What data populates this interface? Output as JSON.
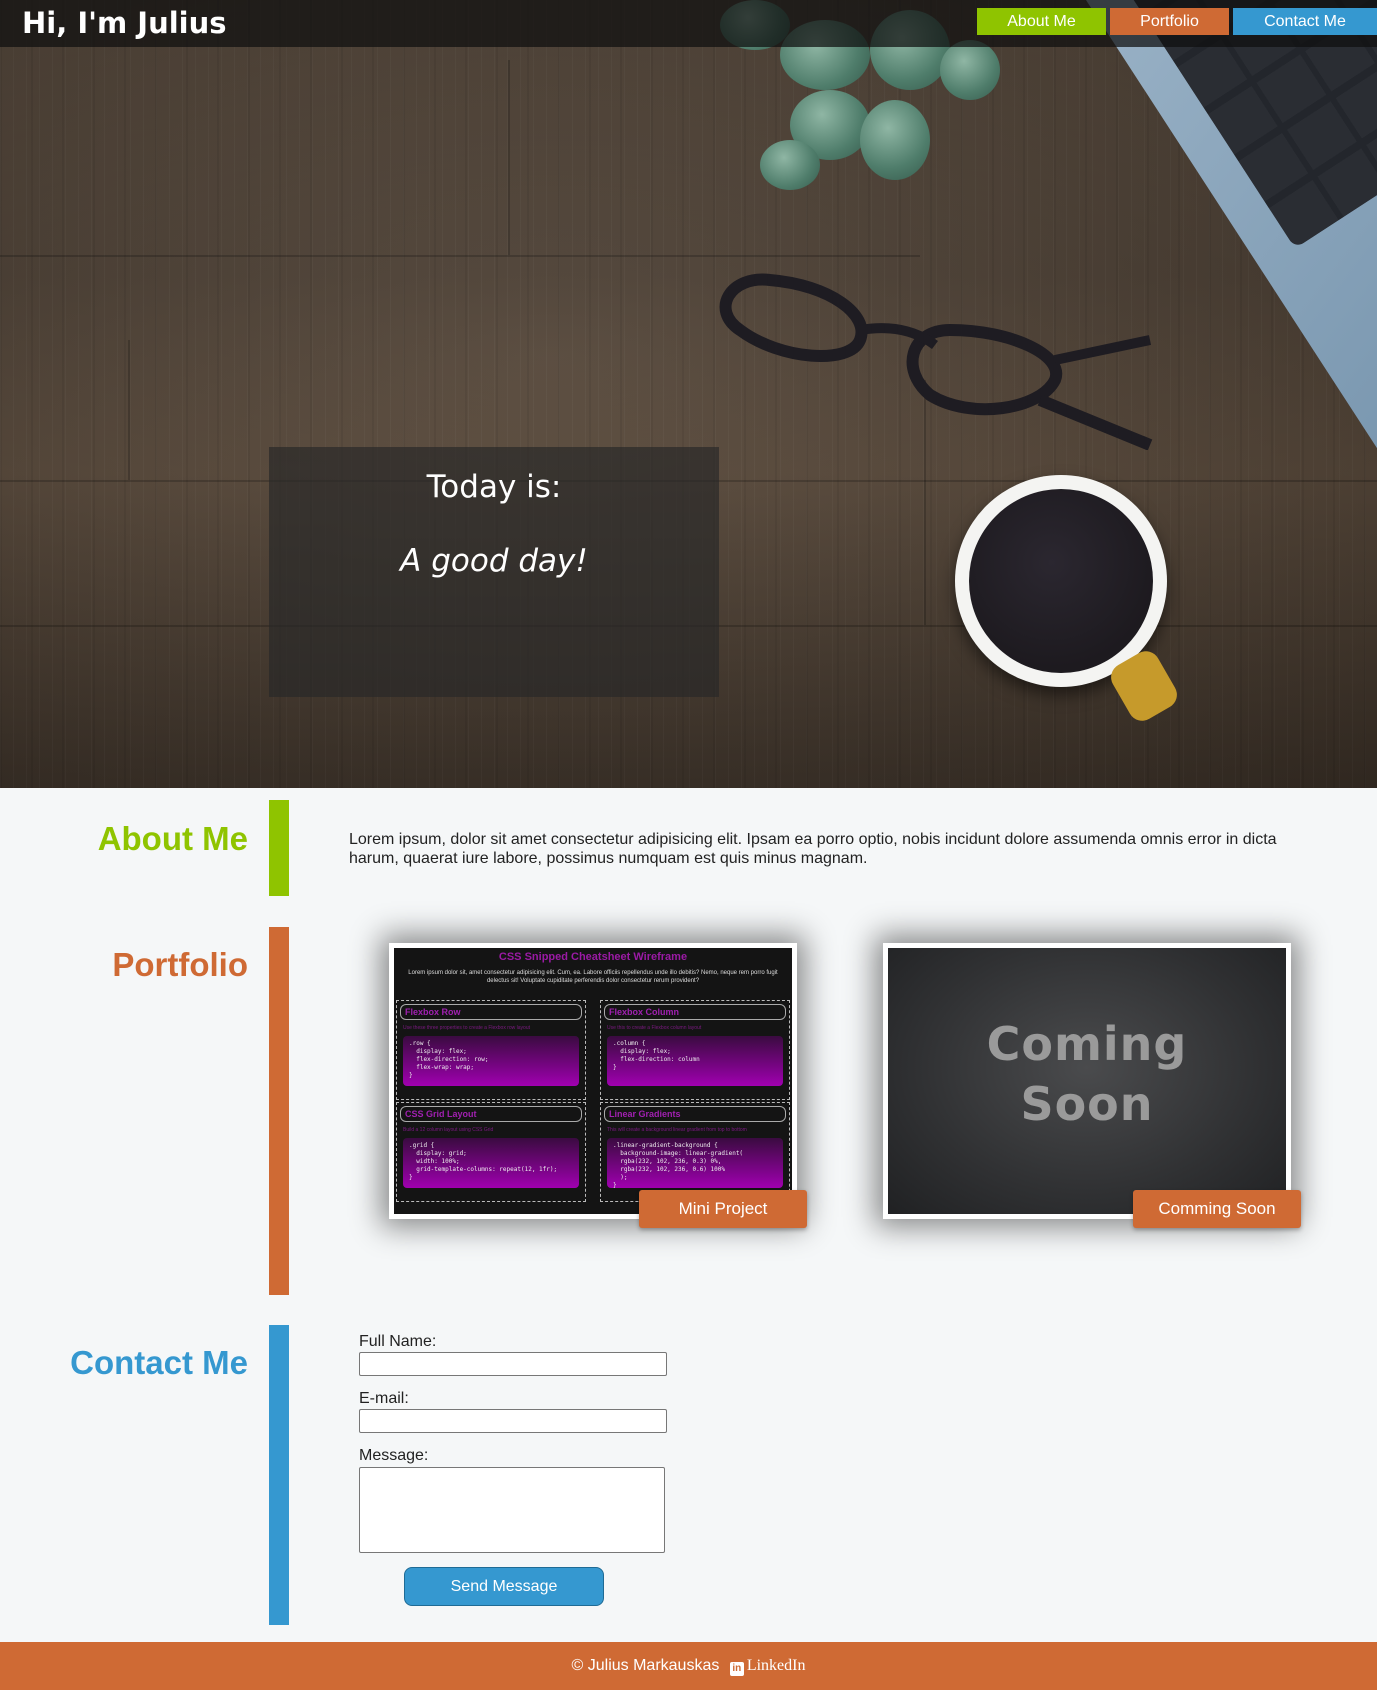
{
  "header": {
    "logo": "Hi, I'm Julius",
    "nav": {
      "about": "About Me",
      "portfolio": "Portfolio",
      "contact": "Contact Me"
    }
  },
  "hero": {
    "line1": "Today is:",
    "line2": "A good day!"
  },
  "about": {
    "title": "About Me",
    "text": "Lorem ipsum, dolor sit amet consectetur adipisicing elit. Ipsam ea porro optio, nobis incidunt dolore assumenda omnis error in dicta harum, quaerat iure labore, possimus numquam est quis minus magnam."
  },
  "portfolio": {
    "title": "Portfolio",
    "items": [
      {
        "label": "Mini Project",
        "preview": {
          "heading": "CSS Snipped Cheatsheet Wireframe",
          "intro": "Lorem ipsum dolor sit, amet consectetur adipisicing elit. Cum, ea. Labore officiis repellendus unde illo debitis? Nemo, neque rem porro fugit delectus sit! Voluptate cupiditate perferendis dolor consectetur rerum provident?",
          "panels": [
            {
              "title": "Flexbox Row",
              "sub": "Use these three properties to create a Flexbox row layout",
              "code": ".row {\n  display: flex;\n  flex-direction: row;\n  flex-wrap: wrap;\n}"
            },
            {
              "title": "Flexbox Column",
              "sub": "Use this to create a Flexbox column layout",
              "code": ".column {\n  display: flex;\n  flex-direction: column\n}"
            },
            {
              "title": "CSS Grid Layout",
              "sub": "Build a 12 column layout using CSS Grid",
              "code": ".grid {\n  display: grid;\n  width: 100%;\n  grid-template-columns: repeat(12, 1fr);\n}"
            },
            {
              "title": "Linear Gradients",
              "sub": "This will create a background linear gradient from top to bottom",
              "code": ".linear-gradient-background {\n  background-image: linear-gradient(\n  rgba(232, 102, 236, 0.3) 0%,\n  rgba(232, 102, 236, 0.6) 100%\n  );\n}"
            }
          ]
        }
      },
      {
        "label": "Comming Soon",
        "preview": {
          "line1": "Coming",
          "line2": "Soon"
        }
      }
    ]
  },
  "contact": {
    "title": "Contact Me",
    "name_label": "Full Name:",
    "email_label": "E-mail:",
    "message_label": "Message:",
    "name_value": "",
    "email_value": "",
    "message_value": "",
    "send_label": "Send Message"
  },
  "footer": {
    "copyright": "© Julius Markauskas",
    "icon": "in",
    "link": "LinkedIn"
  },
  "colors": {
    "green": "#8fc400",
    "orange": "#cf6a34",
    "blue": "#3598d0"
  }
}
